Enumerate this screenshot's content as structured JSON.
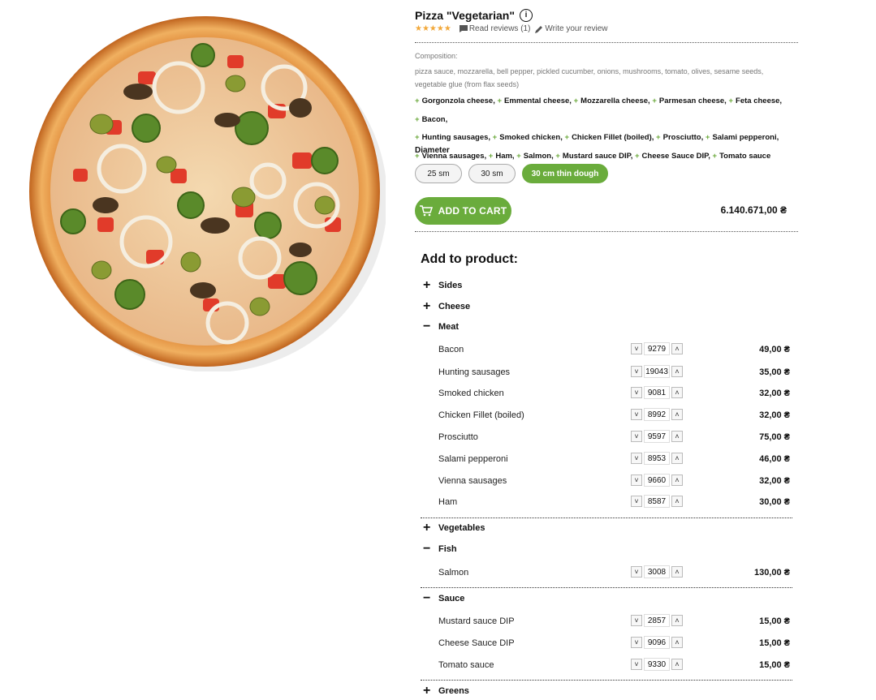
{
  "product": {
    "title": "Pizza \"Vegetarian\"",
    "stars": "★★★★★",
    "read_reviews": "Read reviews (1)",
    "write_review": "Write your review",
    "composition_label": "Composition:",
    "composition": "pizza sauce, mozzarella, bell pepper, pickled cucumber, onions, mushrooms, tomato, olives, sesame seeds, vegetable glue (from flax seeds)",
    "extras": [
      "Gorgonzola cheese,",
      "Emmental cheese,",
      "Mozzarella cheese,",
      "Parmesan cheese,",
      "Feta cheese,",
      "Bacon,",
      "Hunting sausages,",
      "Smoked chicken,",
      "Chicken Fillet (boiled),",
      "Prosciutto,",
      "Salami pepperoni,",
      "Vienna sausages,",
      "Ham,",
      "Salmon,",
      "Mustard sauce DIP,",
      "Cheese Sauce DIP,",
      "Tomato sauce"
    ],
    "diameter_label": "Diameter",
    "diameters": [
      "25 sm",
      "30 sm",
      "30 cm thin dough"
    ],
    "selected_diameter": "30 cm thin dough",
    "add_to_cart": "ADD TO CART",
    "price": "6.140.671,00 ₴"
  },
  "add_to_product": {
    "title": "Add to product:",
    "categories": {
      "sides": {
        "label": "Sides",
        "sign": "+"
      },
      "cheese": {
        "label": "Cheese",
        "sign": "+"
      },
      "meat": {
        "label": "Meat",
        "sign": "−"
      },
      "vegetables": {
        "label": "Vegetables",
        "sign": "+"
      },
      "fish": {
        "label": "Fish",
        "sign": "−"
      },
      "sauce": {
        "label": "Sauce",
        "sign": "−"
      },
      "greens": {
        "label": "Greens",
        "sign": "+"
      }
    },
    "meat": [
      {
        "name": "Bacon",
        "qty": "9279",
        "price": "49,00 ₴"
      },
      {
        "name": "Hunting sausages",
        "qty": "19043",
        "price": "35,00 ₴"
      },
      {
        "name": "Smoked chicken",
        "qty": "9081",
        "price": "32,00 ₴"
      },
      {
        "name": "Chicken Fillet (boiled)",
        "qty": "8992",
        "price": "32,00 ₴"
      },
      {
        "name": "Prosciutto",
        "qty": "9597",
        "price": "75,00 ₴"
      },
      {
        "name": "Salami pepperoni",
        "qty": "8953",
        "price": "46,00 ₴"
      },
      {
        "name": "Vienna sausages",
        "qty": "9660",
        "price": "32,00 ₴"
      },
      {
        "name": "Ham",
        "qty": "8587",
        "price": "30,00 ₴"
      }
    ],
    "fish": [
      {
        "name": "Salmon",
        "qty": "3008",
        "price": "130,00 ₴"
      }
    ],
    "sauce": [
      {
        "name": "Mustard sauce DIP",
        "qty": "2857",
        "price": "15,00 ₴"
      },
      {
        "name": "Cheese Sauce DIP",
        "qty": "9096",
        "price": "15,00 ₴"
      },
      {
        "name": "Tomato sauce",
        "qty": "9330",
        "price": "15,00 ₴"
      }
    ],
    "stepper_down": "˅",
    "stepper_up": "˄"
  },
  "icons": {
    "info": "info-circle-icon",
    "review": "comment-icon",
    "write": "pencil-icon",
    "cart": "cart-icon"
  },
  "colors": {
    "accent": "#6aac3c",
    "stars": "#f2a83a"
  }
}
